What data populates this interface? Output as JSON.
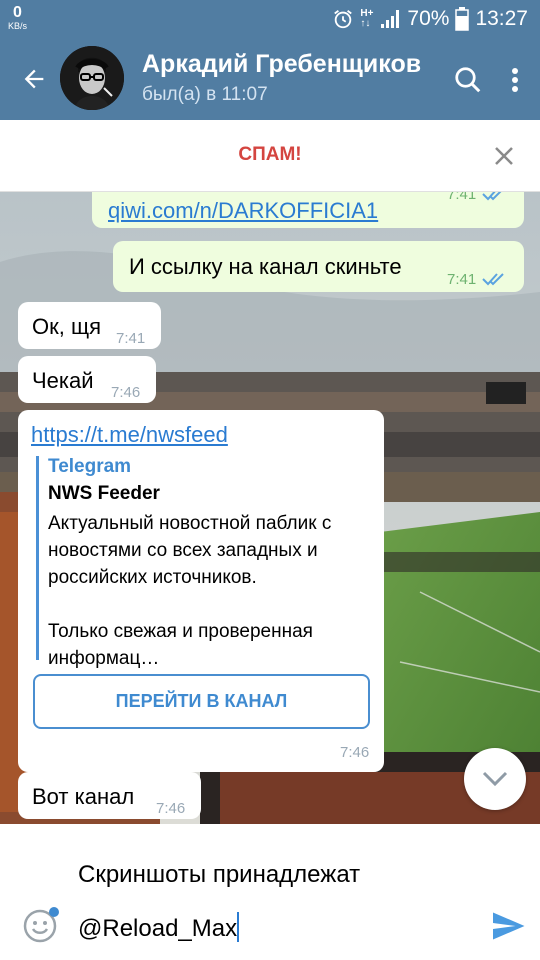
{
  "status_bar": {
    "net_speed": "0",
    "net_unit": "KB/s",
    "battery": "70%",
    "time": "13:27"
  },
  "header": {
    "contact_name": "Аркадий Гребенщиков",
    "last_seen": "был(а) в 11:07"
  },
  "spam_bar": {
    "label": "СПАМ!"
  },
  "messages": [
    {
      "text": "qiwi.com/n/DARKOFFICIA1",
      "time": "7:41",
      "outgoing": true
    },
    {
      "text": "И ссылку на канал скиньте",
      "time": "7:41",
      "outgoing": true
    },
    {
      "text": "Ок, щя",
      "time": "7:41",
      "outgoing": false
    },
    {
      "text": "Чекай",
      "time": "7:46",
      "outgoing": false
    },
    {
      "url": "https://t.me/nwsfeed",
      "preview_site": "Telegram",
      "preview_title": "NWS Feeder",
      "preview_description": "Актуальный новостной паблик с новостями со всех западных и российских источников.\n\nТолько свежая и проверенная информац…",
      "button_label": "ПЕРЕЙТИ В КАНАЛ",
      "time": "7:46",
      "outgoing": false
    },
    {
      "text": "Вот канал",
      "time": "7:46",
      "outgoing": false
    }
  ],
  "input": {
    "text": "Скриншоты принадлежат\n@Reload_Max"
  },
  "colors": {
    "header_bg": "#517da2",
    "spam_red": "#d44540",
    "link_blue": "#2a7bd1",
    "outgoing_bubble": "#effdde"
  },
  "icons": [
    "back-arrow-icon",
    "search-icon",
    "more-vert-icon",
    "close-icon",
    "double-check-icon",
    "chevron-down-icon",
    "emoji-icon",
    "send-icon",
    "alarm-icon",
    "signal-icon",
    "battery-icon"
  ]
}
